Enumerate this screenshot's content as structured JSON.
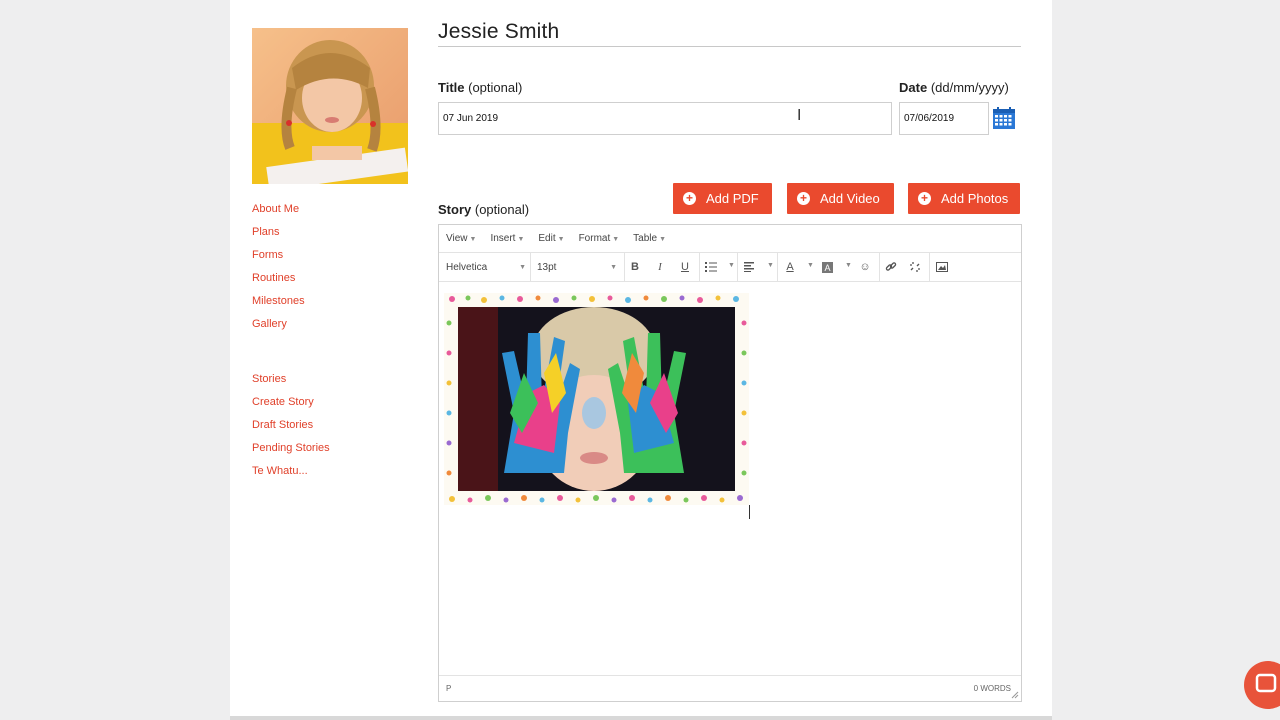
{
  "sidebar": {
    "profile_photo_alt": "child-reading-photo",
    "nav_group_1": [
      "About Me",
      "Plans",
      "Forms",
      "Routines",
      "Milestones",
      "Gallery"
    ],
    "nav_group_2": [
      "Stories",
      "Create Story",
      "Draft Stories",
      "Pending Stories",
      "Te Whatu..."
    ]
  },
  "header": {
    "name": "Jessie Smith"
  },
  "form": {
    "title_label": "Title",
    "title_hint": "(optional)",
    "title_value": "07 Jun 2019",
    "date_label": "Date",
    "date_hint": "(dd/mm/yyyy)",
    "date_value": "07/06/2019",
    "story_label": "Story",
    "story_hint": "(optional)"
  },
  "buttons": {
    "add_pdf": "Add PDF",
    "add_video": "Add Video",
    "add_photos": "Add Photos"
  },
  "editor": {
    "menus": [
      "View",
      "Insert",
      "Edit",
      "Format",
      "Table"
    ],
    "font_family": "Helvetica",
    "font_size": "13pt",
    "status_path": "P",
    "word_count": "0 WORDS"
  },
  "icons": {
    "calendar": "calendar-icon",
    "bold": "bold-icon",
    "italic": "italic-icon",
    "underline": "underline-icon",
    "bullet_list": "bullet-list-icon",
    "align": "align-icon",
    "text_color": "text-color-icon",
    "bg_color": "background-color-icon",
    "emoji": "emoji-icon",
    "link": "link-icon",
    "unlink": "unlink-icon",
    "image": "image-icon",
    "chat": "chat-icon"
  },
  "colors": {
    "accent": "#ea4a2e",
    "link": "#e0402a",
    "calendar": "#2a78d6"
  }
}
